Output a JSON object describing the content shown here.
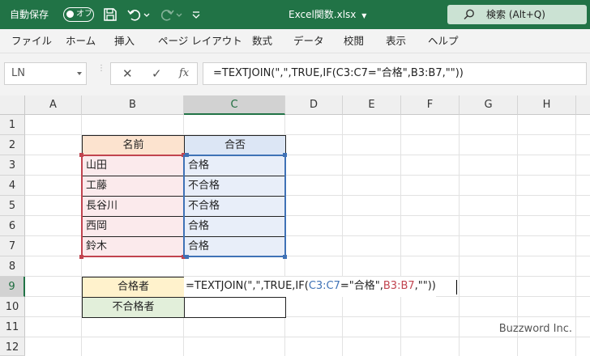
{
  "titlebar": {
    "autosave_label": "自動保存",
    "autosave_state": "オフ",
    "filename": "Excel関数.xlsx",
    "search_label": "検索 (Alt+Q)",
    "accent_color": "#217346"
  },
  "ribbon": {
    "tabs": [
      "ファイル",
      "ホーム",
      "挿入",
      "ページ レイアウト",
      "数式",
      "データ",
      "校閲",
      "表示",
      "ヘルプ"
    ]
  },
  "formula_bar": {
    "name_box": "LN",
    "cancel_icon": "✕",
    "enter_icon": "✓",
    "fx_label": "fx",
    "formula": "=TEXTJOIN(\",\",TRUE,IF(C3:C7=\"合格\",B3:B7,\"\"))"
  },
  "sheet": {
    "columns": [
      "A",
      "B",
      "C",
      "D",
      "E",
      "F",
      "G",
      "H"
    ],
    "selected_column": "C",
    "rows": [
      "1",
      "2",
      "3",
      "4",
      "5",
      "6",
      "7",
      "8",
      "9",
      "10",
      "11",
      "12"
    ],
    "selected_row": "9",
    "header_name": "名前",
    "header_result": "合否",
    "names": [
      "山田",
      "工藤",
      "長谷川",
      "西岡",
      "鈴木"
    ],
    "results": [
      "合格",
      "不合格",
      "不合格",
      "合格",
      "合格"
    ],
    "pass_label": "合格者",
    "fail_label": "不合格者",
    "editing": {
      "p1": "=TEXTJOIN(\",\",TRUE,IF(",
      "ref1": "C3:C7",
      "p2": "=\"合格\",",
      "ref2": "B3:B7",
      "p3": ",\"\"))"
    }
  },
  "watermark": "Buzzword Inc."
}
